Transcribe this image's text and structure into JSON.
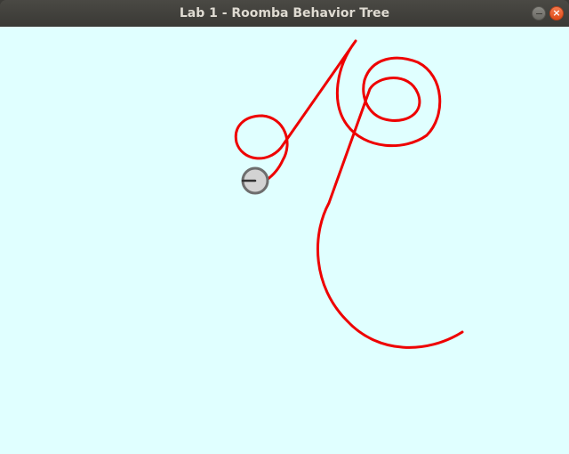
{
  "window": {
    "title": "Lab 1 - Roomba Behavior Tree",
    "minimize_icon": "minimize-icon",
    "close_icon": "close-icon",
    "close_glyph": "×"
  },
  "canvas": {
    "background": "#e0ffff",
    "path_color": "#ee0000",
    "robot_body_color": "#d3d3d3",
    "robot_border_color": "#6e6e6e",
    "robot_heading_color": "#333333"
  }
}
